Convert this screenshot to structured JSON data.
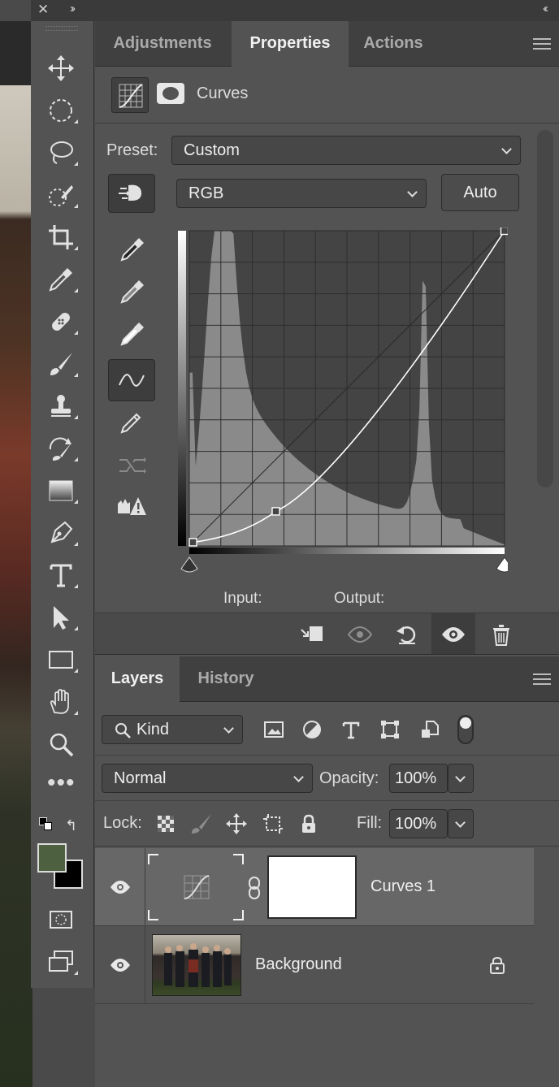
{
  "colors": {
    "panel_bg": "#535353",
    "tab_bg": "#404040",
    "selected_layer": "#676767",
    "foreground_color": "#4d6040",
    "background_color": "#000000"
  },
  "panel_tabs": [
    {
      "label": "Adjustments",
      "active": false
    },
    {
      "label": "Properties",
      "active": true
    },
    {
      "label": "Actions",
      "active": false
    }
  ],
  "properties": {
    "title": "Curves",
    "preset_label": "Preset:",
    "preset_value": "Custom",
    "channel_value": "RGB",
    "auto_label": "Auto",
    "input_label": "Input:",
    "output_label": "Output:",
    "curve_points": [
      {
        "input": 3,
        "output": 3
      },
      {
        "input": 70,
        "output": 28
      },
      {
        "input": 255,
        "output": 255
      }
    ]
  },
  "layers_tabs": [
    {
      "label": "Layers",
      "active": true
    },
    {
      "label": "History",
      "active": false
    }
  ],
  "layers": {
    "filter_value": "Kind",
    "blend_mode": "Normal",
    "opacity_label": "Opacity:",
    "opacity_value": "100%",
    "lock_label": "Lock:",
    "fill_label": "Fill:",
    "fill_value": "100%",
    "items": [
      {
        "name": "Curves 1",
        "selected": true
      },
      {
        "name": "Background",
        "selected": false
      }
    ]
  }
}
